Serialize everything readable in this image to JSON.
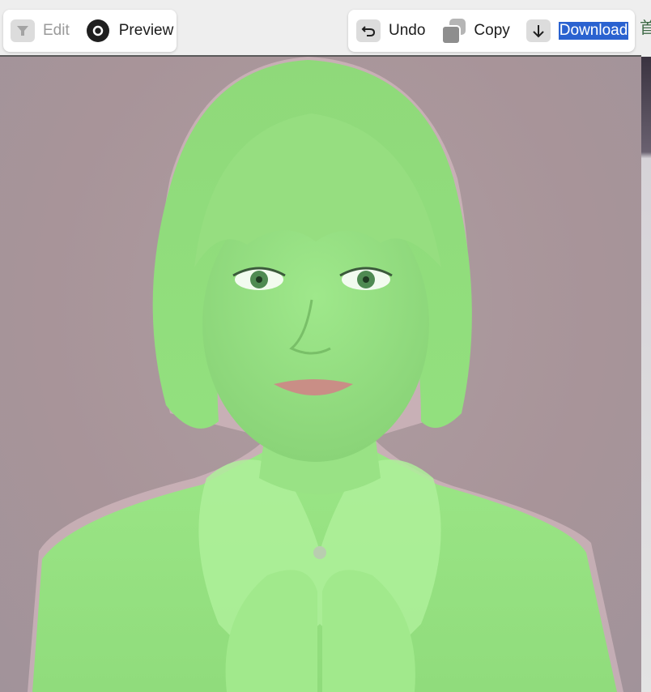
{
  "toolbar_left": {
    "edit_label": "Edit",
    "preview_label": "Preview"
  },
  "toolbar_right": {
    "undo_label": "Undo",
    "copy_label": "Copy",
    "download_label": "Download"
  },
  "edge_glyph": "首",
  "icons": {
    "edit": "funnel-icon",
    "preview": "eye-icon",
    "undo": "undo-arrow-icon",
    "copy": "copy-icon",
    "download": "arrow-down-icon"
  },
  "colors": {
    "mask_overlay": "#8fe27a",
    "background": "#a8969b",
    "selection_highlight": "#2a62d0"
  }
}
